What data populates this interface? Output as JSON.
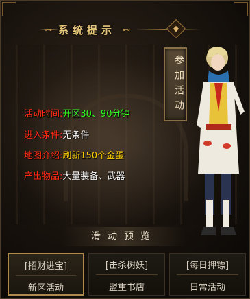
{
  "dialog": {
    "title": "系统提示",
    "close_symbol": "◆"
  },
  "join_button": {
    "label": "参加活动"
  },
  "info_lines": [
    {
      "key": "活动时间:",
      "value": "开区30、90分钟",
      "value_color": "green"
    },
    {
      "key": "进入条件:",
      "value": "无条件",
      "value_color": "white"
    },
    {
      "key": "地图介绍:",
      "value": "刷新150个金蛋",
      "value_color": "yellow"
    },
    {
      "key": "产出物品:",
      "value": "大量装备、武器",
      "value_color": "white"
    }
  ],
  "slide_preview": {
    "label": "滑动预览"
  },
  "tabs": [
    {
      "top": "[招财进宝]",
      "bottom": "新区活动",
      "active": true
    },
    {
      "top": "[击杀树妖]",
      "bottom": "盟重书店",
      "active": false
    },
    {
      "top": "[每日押镖]",
      "bottom": "日常活动",
      "active": false
    }
  ],
  "colors": {
    "key_red": "#ff2a14",
    "value_green": "#30ff20",
    "value_yellow": "#ffd000",
    "gold_border": "#b08a48"
  }
}
